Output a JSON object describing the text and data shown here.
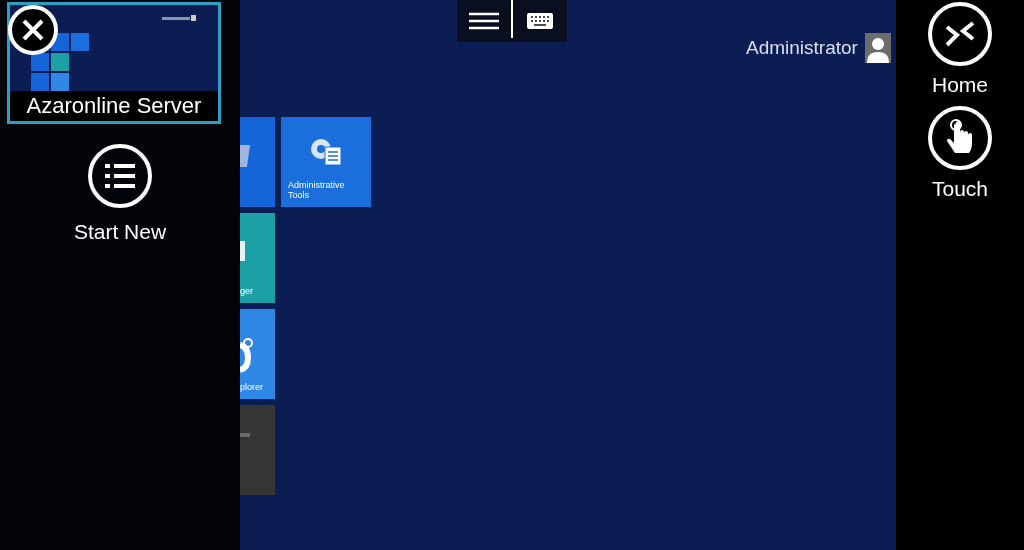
{
  "toolbar": {
    "buttons": [
      {
        "kind": "menu"
      },
      {
        "kind": "keyboard"
      }
    ]
  },
  "remote_desktop": {
    "user": "Administrator",
    "edge_tiles": [
      {
        "kind": "terminal",
        "color": "#1565d8"
      },
      {
        "kind": "monitor",
        "label": "ger",
        "color": "#1ba0a6"
      },
      {
        "kind": "browser",
        "label": "plorer",
        "color": "#2f87e6"
      },
      {
        "kind": "desktop",
        "color": "#353535"
      }
    ],
    "tiles": [
      {
        "kind": "tools",
        "label": "Administrative Tools",
        "color": "#1a6fdc"
      }
    ]
  },
  "session_panel": {
    "sessions": [
      {
        "title": "Azaronline Server",
        "selected": true
      }
    ],
    "start_new": {
      "label": "Start New"
    }
  },
  "side_actions": [
    {
      "kind": "home",
      "label": "Home"
    },
    {
      "kind": "touch",
      "label": "Touch"
    }
  ]
}
